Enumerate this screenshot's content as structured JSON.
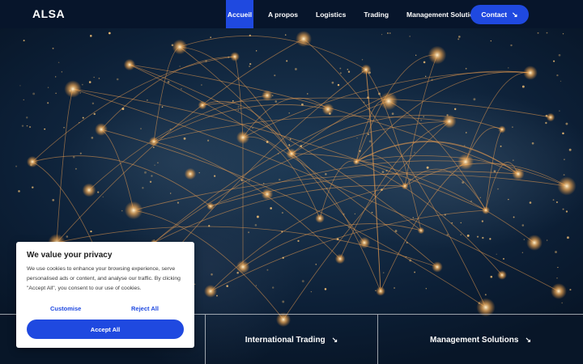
{
  "header": {
    "logo": "ALSA",
    "nav": [
      {
        "label": "Accueil",
        "active": true
      },
      {
        "label": "A propos",
        "active": false
      },
      {
        "label": "Logistics",
        "active": false
      },
      {
        "label": "Trading",
        "active": false
      },
      {
        "label": "Management Solutions",
        "active": false
      }
    ],
    "contact_label": "Contact",
    "contact_icon": "arrow-down-right-icon"
  },
  "bottom_links": [
    {
      "label": "International Trading",
      "icon": "arrow-down-right-icon"
    },
    {
      "label": "Management Solutions",
      "icon": "arrow-down-right-icon"
    }
  ],
  "cookie_banner": {
    "title": "We value your privacy",
    "text": "We use cookies to enhance your browsing experience, serve personalised ads or content, and analyse our traffic. By clicking \"Accept All\", you consent to our use of cookies.",
    "customise_label": "Customise",
    "reject_label": "Reject All",
    "accept_label": "Accept All"
  },
  "colors": {
    "accent": "#1f49e0",
    "header_bg": "#07152b",
    "glow": "#ffb45a"
  }
}
